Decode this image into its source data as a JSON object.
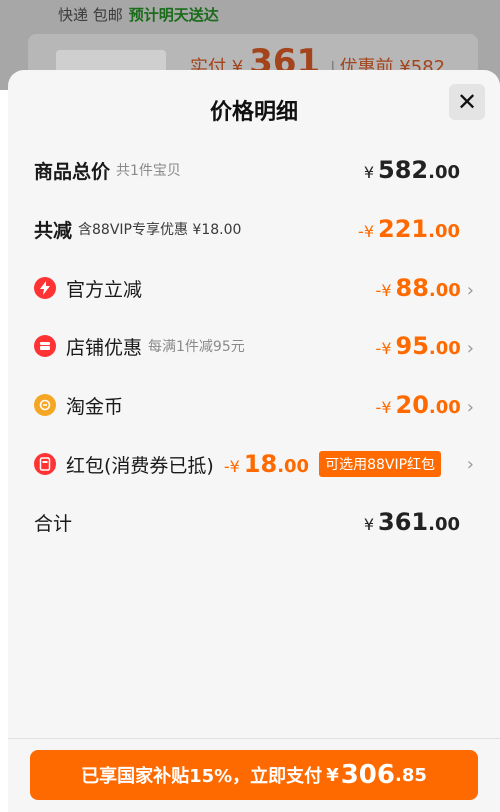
{
  "background": {
    "delivery_prefix": "快递 包邮",
    "delivery_eta": "预计明天送达",
    "price_label": "实付 ¥",
    "price_value": "361",
    "original_label": "优惠前 ¥582"
  },
  "sheet": {
    "title": "价格明细",
    "close_label": "✕"
  },
  "rows": {
    "total": {
      "label": "商品总价",
      "sub": "共1件宝贝",
      "yen": "¥",
      "int": "582",
      "dec": ".00"
    },
    "reduced": {
      "label": "共减",
      "sub": "含88VIP专享优惠 ¥18.00",
      "yen": "-¥",
      "int": "221",
      "dec": ".00"
    },
    "official": {
      "label": "官方立减",
      "yen": "-¥",
      "int": "88",
      "dec": ".00"
    },
    "shop": {
      "label": "店铺优惠",
      "sub": "每满1件减95元",
      "yen": "-¥",
      "int": "95",
      "dec": ".00"
    },
    "coin": {
      "label": "淘金币",
      "yen": "-¥",
      "int": "20",
      "dec": ".00"
    },
    "redpacket": {
      "label": "红包(消费券已抵)",
      "yen": "-¥",
      "int": "18",
      "dec": ".00",
      "tag": "可选用88VIP红包"
    },
    "sum": {
      "label": "合计",
      "yen": "¥",
      "int": "361",
      "dec": ".00"
    }
  },
  "pay_button": {
    "text": "已享国家补贴15%，立即支付",
    "yen": "¥",
    "int": "306",
    "dec": ".85"
  },
  "colors": {
    "accent": "#ff6a00",
    "icon_red": "#ff3333",
    "icon_gold": "#f5a623"
  },
  "icons": [
    "lightning-icon",
    "shop-icon",
    "coin-icon",
    "red-packet-icon",
    "close-icon",
    "chevron-right-icon"
  ]
}
